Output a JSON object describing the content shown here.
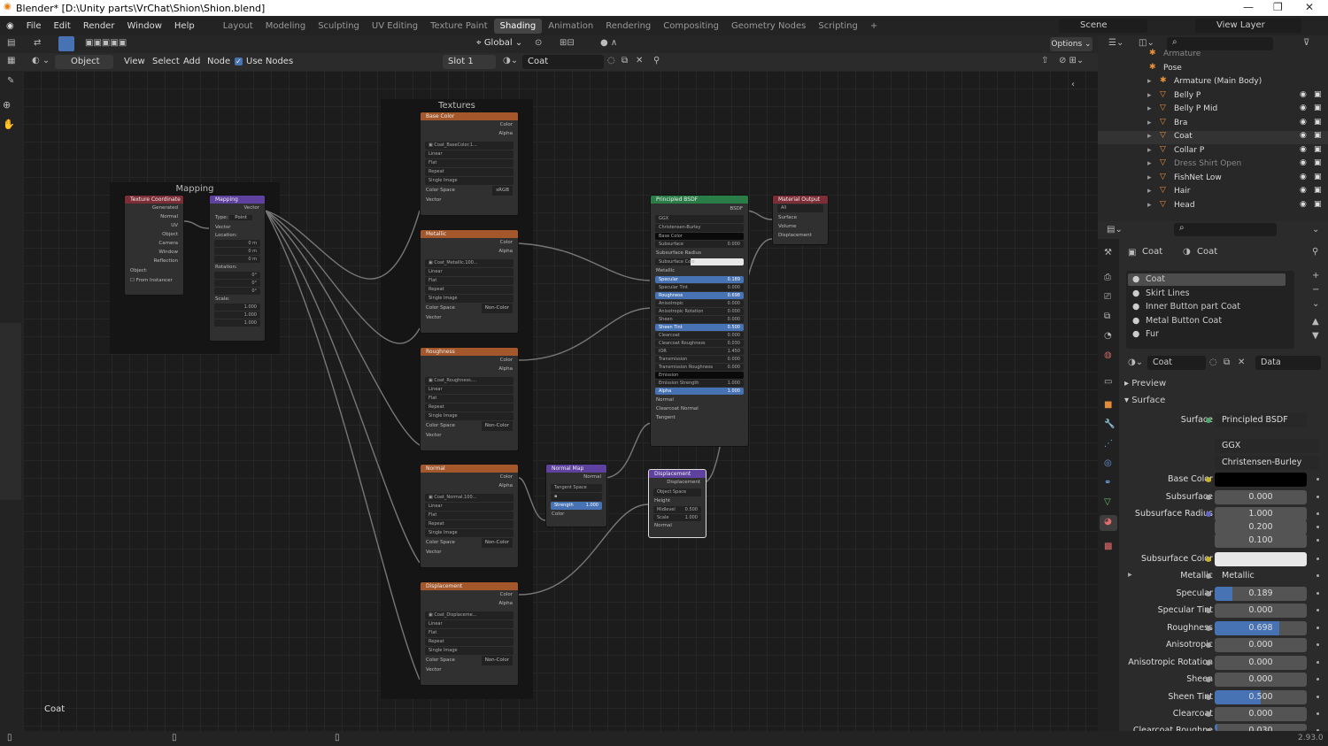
{
  "titlebar": {
    "title": "Blender* [D:\\Unity parts\\VrChat\\Shion\\Shion.blend]"
  },
  "menu": {
    "items": [
      "File",
      "Edit",
      "Render",
      "Window",
      "Help"
    ]
  },
  "workspaces": [
    "Layout",
    "Modeling",
    "Sculpting",
    "UV Editing",
    "Texture Paint",
    "Shading",
    "Animation",
    "Rendering",
    "Compositing",
    "Geometry Nodes",
    "Scripting"
  ],
  "active_workspace": "Shading",
  "scene": {
    "label": "Scene",
    "view_layer": "View Layer"
  },
  "toolbar": {
    "transform": "Global",
    "options": "Options"
  },
  "node_header": {
    "mode": "Object",
    "view": "View",
    "select": "Select",
    "add": "Add",
    "node": "Node",
    "use_nodes": "Use Nodes",
    "slot": "Slot 1",
    "material": "Coat"
  },
  "canvas": {
    "material_label": "Coat"
  },
  "frames": {
    "mapping": "Mapping",
    "textures": "Textures"
  },
  "nodes": {
    "texcoord": {
      "title": "Texture Coordinate",
      "outputs": [
        "Generated",
        "Normal",
        "UV",
        "Object",
        "Camera",
        "Window",
        "Reflection"
      ],
      "object": "Object:",
      "from_instancer": "From Instancer"
    },
    "mapping": {
      "title": "Mapping",
      "out": "Vector",
      "type_label": "Type:",
      "type": "Point",
      "vector": "Vector",
      "location": "Location:",
      "rotation": "Rotation:",
      "scale": "Scale:",
      "loc": [
        "0 m",
        "0 m",
        "0 m"
      ],
      "rot": [
        "0°",
        "0°",
        "0°"
      ],
      "scl": [
        "1.000",
        "1.000",
        "1.000"
      ]
    },
    "tex_base": {
      "title": "Base Color",
      "image": "Coat_BaseColor.1...",
      "colorspace": "sRGB"
    },
    "tex_metal": {
      "title": "Metallic",
      "image": "Coat_Metallic.100...",
      "colorspace": "Non-Color"
    },
    "tex_rough": {
      "title": "Roughness",
      "image": "Coat_Roughness....",
      "colorspace": "Non-Color"
    },
    "tex_normal": {
      "title": "Normal",
      "image": "Coat_Normal.100...",
      "colorspace": "Non-Color"
    },
    "tex_disp": {
      "title": "Displacement",
      "image": "Coat_Displaceme...",
      "colorspace": "Non-Color"
    },
    "tex_common": {
      "color": "Color",
      "alpha": "Alpha",
      "interp": "Linear",
      "proj": "Flat",
      "ext": "Repeat",
      "src": "Single Image",
      "cs_label": "Color Space",
      "vector": "Vector"
    },
    "normalmap": {
      "title": "Normal Map",
      "out": "Normal",
      "space": "Tangent Space",
      "strength_label": "Strength",
      "strength": "1.000",
      "color": "Color"
    },
    "displacement": {
      "title": "Displacement",
      "out": "Displacement",
      "space": "Object Space",
      "height": "Height",
      "midlevel_label": "Midlevel",
      "midlevel": "0.500",
      "scale_label": "Scale",
      "scale": "1.000",
      "normal": "Normal"
    },
    "bsdf": {
      "title": "Principled BSDF",
      "out": "BSDF",
      "dist": "GGX",
      "sss": "Christensen-Burley",
      "rows": [
        [
          "Base Color",
          ""
        ],
        [
          "Subsurface",
          "0.000"
        ],
        [
          "Subsurface Radius",
          ""
        ],
        [
          "Subsurface Colo",
          ""
        ],
        [
          "Metallic",
          ""
        ],
        [
          "Specular",
          "0.189"
        ],
        [
          "Specular Tint",
          "0.000"
        ],
        [
          "Roughness",
          "0.698"
        ],
        [
          "Anisotropic",
          "0.000"
        ],
        [
          "Anisotropic Rotation",
          "0.000"
        ],
        [
          "Sheen",
          "0.000"
        ],
        [
          "Sheen Tint",
          "0.500"
        ],
        [
          "Clearcoat",
          "0.000"
        ],
        [
          "Clearcoat Roughness",
          "0.030"
        ],
        [
          "IOR",
          "1.450"
        ],
        [
          "Transmission",
          "0.000"
        ],
        [
          "Transmission Roughness",
          "0.000"
        ],
        [
          "Emission",
          ""
        ],
        [
          "Emission Strength",
          "1.000"
        ],
        [
          "Alpha",
          "1.000"
        ],
        [
          "Normal",
          ""
        ],
        [
          "Clearcoat Normal",
          ""
        ],
        [
          "Tangent",
          ""
        ]
      ]
    },
    "matout": {
      "title": "Material Output",
      "target": "All",
      "inputs": [
        "Surface",
        "Volume",
        "Displacement"
      ]
    }
  },
  "outliner": {
    "items": [
      {
        "name": "Armature",
        "dim": true
      },
      {
        "name": "Pose",
        "dim": false
      },
      {
        "name": "Armature (Main Body)",
        "dim": false
      },
      {
        "name": "Belly P",
        "dim": false
      },
      {
        "name": "Belly P Mid",
        "dim": false
      },
      {
        "name": "Bra",
        "dim": false
      },
      {
        "name": "Coat",
        "dim": false
      },
      {
        "name": "Collar P",
        "dim": false
      },
      {
        "name": "Dress Shirt Open",
        "dim": true
      },
      {
        "name": "FishNet Low",
        "dim": false
      },
      {
        "name": "Hair",
        "dim": false
      },
      {
        "name": "Head",
        "dim": false
      }
    ]
  },
  "props": {
    "breadcrumb": {
      "object": "Coat",
      "material": "Coat"
    },
    "slots": [
      "Coat",
      "Skirt Lines",
      "Inner Button part Coat",
      "Metal Button Coat",
      "Fur"
    ],
    "material_name": "Coat",
    "data": "Data",
    "preview": "Preview",
    "surface_panel": "Surface",
    "surface_label": "Surface",
    "surface_value": "Principled BSDF",
    "dist": "GGX",
    "sss_method": "Christensen-Burley",
    "fields": [
      {
        "label": "Base Color",
        "type": "color",
        "value": "",
        "color": "#000000"
      },
      {
        "label": "Subsurface",
        "type": "num",
        "value": "0.000"
      },
      {
        "label": "Subsurface Radius",
        "type": "num",
        "value": "1.000"
      },
      {
        "label": "",
        "type": "num",
        "value": "0.200"
      },
      {
        "label": "",
        "type": "num",
        "value": "0.100"
      },
      {
        "label": "Subsurface Color",
        "type": "color",
        "value": "",
        "color": "#e8e8e8"
      },
      {
        "label": "Metallic",
        "type": "link",
        "value": "Metallic"
      },
      {
        "label": "Specular",
        "type": "num",
        "value": "0.189",
        "fill": 0.189
      },
      {
        "label": "Specular Tint",
        "type": "num",
        "value": "0.000"
      },
      {
        "label": "Roughness",
        "type": "num",
        "value": "0.698",
        "fill": 0.698
      },
      {
        "label": "Anisotropic",
        "type": "num",
        "value": "0.000"
      },
      {
        "label": "Anisotropic Rotation",
        "type": "num",
        "value": "0.000"
      },
      {
        "label": "Sheen",
        "type": "num",
        "value": "0.000"
      },
      {
        "label": "Sheen Tint",
        "type": "num",
        "value": "0.500",
        "fill": 0.5
      },
      {
        "label": "Clearcoat",
        "type": "num",
        "value": "0.000"
      },
      {
        "label": "Clearcoat Roughne",
        "type": "num",
        "value": "0.030",
        "fill": 0.03
      }
    ]
  },
  "status": {
    "version": "2.93.0"
  }
}
